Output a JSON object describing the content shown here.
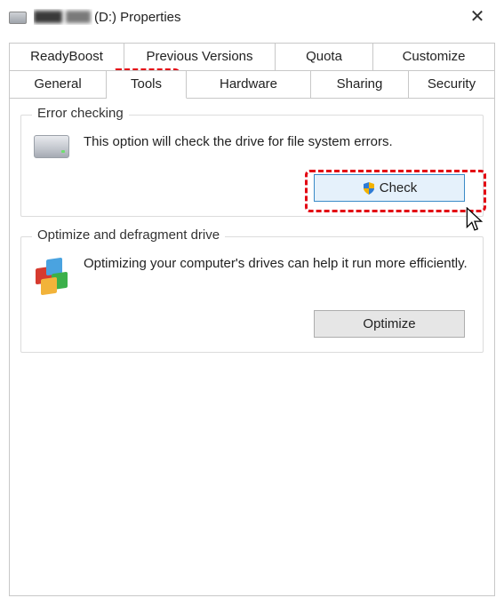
{
  "title": {
    "drive_suffix": "(D:) Properties"
  },
  "tabs": {
    "row1": {
      "readyboost": "ReadyBoost",
      "previous_versions": "Previous Versions",
      "quota": "Quota",
      "customize": "Customize"
    },
    "row2": {
      "general": "General",
      "tools": "Tools",
      "hardware": "Hardware",
      "sharing": "Sharing",
      "security": "Security"
    },
    "active": "tools"
  },
  "error_checking": {
    "legend": "Error checking",
    "description": "This option will check the drive for file system errors.",
    "button": "Check",
    "button_icon": "uac-shield-icon"
  },
  "optimize": {
    "legend": "Optimize and defragment drive",
    "description": "Optimizing your computer's drives can help it run more efficiently.",
    "button": "Optimize"
  },
  "close_glyph": "✕"
}
